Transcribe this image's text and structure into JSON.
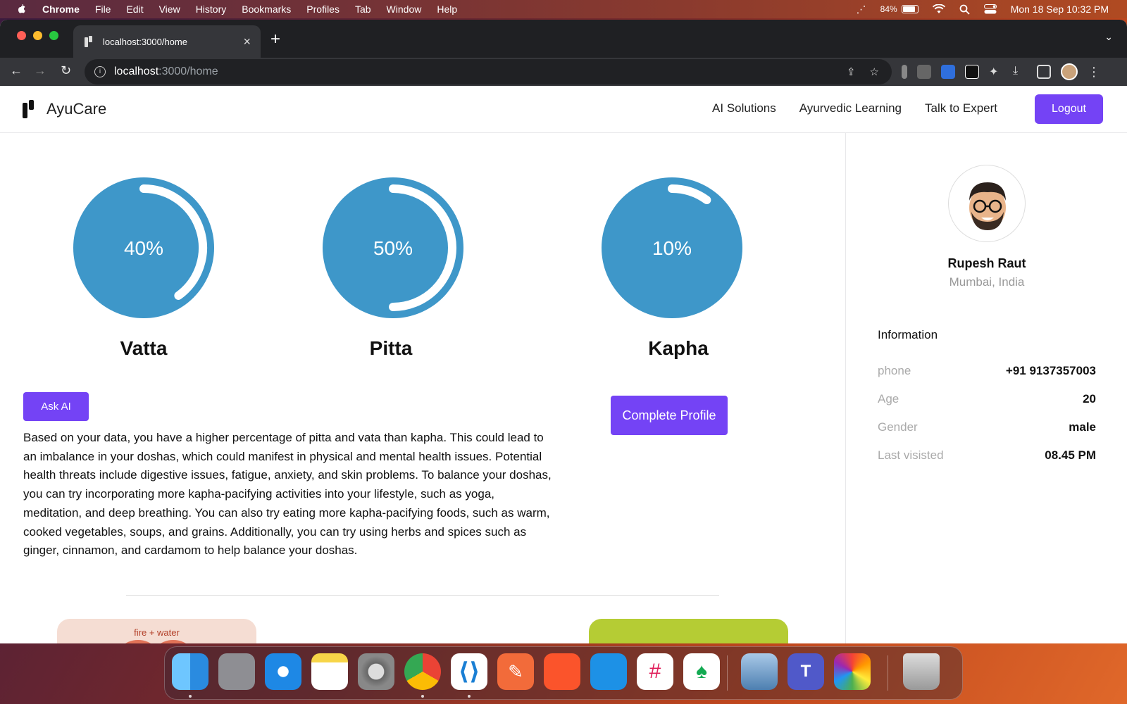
{
  "menubar": {
    "app": "Chrome",
    "items": [
      "File",
      "Edit",
      "View",
      "History",
      "Bookmarks",
      "Profiles",
      "Tab",
      "Window",
      "Help"
    ],
    "battery": "84%",
    "datetime": "Mon 18 Sep  10:32 PM"
  },
  "browser": {
    "tab_title": "localhost:3000/home",
    "url_host": "localhost",
    "url_path": ":3000/home"
  },
  "app": {
    "brand": "AyuCare",
    "nav": [
      "AI Solutions",
      "Ayurvedic Learning",
      "Talk to Expert"
    ],
    "logout_label": "Logout"
  },
  "doshas": [
    {
      "name": "Vatta",
      "percent_label": "40%",
      "value": 40
    },
    {
      "name": "Pitta",
      "percent_label": "50%",
      "value": 50
    },
    {
      "name": "Kapha",
      "percent_label": "10%",
      "value": 10
    }
  ],
  "colors": {
    "accent": "#7443f5",
    "gauge_fill": "#3e97c9",
    "gauge_arc": "#ffffff"
  },
  "actions": {
    "ask_ai": "Ask AI",
    "complete_profile": "Complete Profile"
  },
  "analysis_text": "Based on your data, you have a higher percentage of pitta and vata than kapha. This could lead to an imbalance in your doshas, which could manifest in physical and mental health issues. Potential health threats include digestive issues, fatigue, anxiety, and skin problems. To balance your doshas, you can try incorporating more kapha-pacifying activities into your lifestyle, such as yoga, meditation, and deep breathing. You can also try eating more kapha-pacifying foods, such as warm, cooked vegetables, soups, and grains. Additionally, you can try using herbs and spices such as ginger, cinnamon, and cardamom to help balance your doshas.",
  "cards": {
    "card1_label": "fire + water"
  },
  "profile": {
    "name": "Rupesh Raut",
    "location": "Mumbai, India",
    "info_title": "Information",
    "rows": [
      {
        "label": "phone",
        "value": "+91 9137357003"
      },
      {
        "label": "Age",
        "value": "20"
      },
      {
        "label": "Gender",
        "value": "male"
      },
      {
        "label": "Last visisted",
        "value": "08.45 PM"
      }
    ]
  },
  "dock": {
    "apps": [
      "finder-icon",
      "launchpad-icon",
      "safari-icon",
      "notes-icon",
      "system-settings-icon",
      "chrome-icon",
      "vscode-icon",
      "postman-icon",
      "brave-icon",
      "docker-icon",
      "slack-icon",
      "mongodb-compass-icon",
      "preview-icon",
      "teams-icon",
      "photos-icon",
      "trash-icon"
    ]
  }
}
